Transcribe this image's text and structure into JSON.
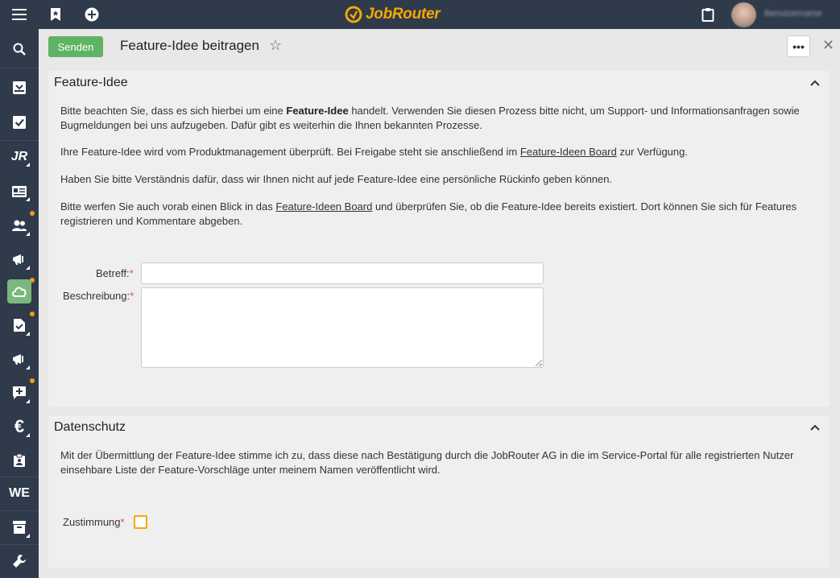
{
  "topbar": {
    "logo_text": "JobRouter",
    "icons": [
      "menu-icon",
      "bookmark-icon",
      "add-circle-icon",
      "clipboard-icon"
    ],
    "username": "Benutzername"
  },
  "sidebar": {
    "items": [
      {
        "name": "search-icon",
        "badge": false
      },
      {
        "name": "inbox-icon",
        "badge": false
      },
      {
        "name": "task-check-icon",
        "badge": false
      },
      {
        "name": "jr-icon",
        "text": "JR",
        "badge": false
      },
      {
        "name": "card-icon",
        "badge": false
      },
      {
        "name": "people-icon",
        "badge": true
      },
      {
        "name": "megaphone-icon",
        "badge": false
      },
      {
        "name": "cloud-icon",
        "badge": true,
        "active": true
      },
      {
        "name": "document-check-icon",
        "badge": true
      },
      {
        "name": "megaphone-2-icon",
        "badge": false
      },
      {
        "name": "feedback-icon",
        "badge": true
      },
      {
        "name": "euro-icon",
        "text": "€",
        "badge": false
      },
      {
        "name": "badge-icon",
        "badge": false
      },
      {
        "name": "we-icon",
        "text": "WE",
        "badge": false
      },
      {
        "name": "archive-icon",
        "badge": false
      },
      {
        "name": "wrench-icon",
        "badge": false
      }
    ]
  },
  "header": {
    "send_label": "Senden",
    "title": "Feature-Idee beitragen",
    "more_label": "•••"
  },
  "feature_panel": {
    "title": "Feature-Idee",
    "p1_a": "Bitte beachten Sie, dass es sich hierbei um eine ",
    "p1_b": "Feature-Idee",
    "p1_c": " handelt. Verwenden Sie diesen Prozess bitte nicht, um Support- und Informationsanfragen sowie Bugmeldungen bei uns aufzugeben. Dafür gibt es weiterhin die Ihnen bekannten Prozesse.",
    "p2_a": "Ihre Feature-Idee wird vom Produktmanagement überprüft. Bei Freigabe steht sie anschließend im ",
    "p2_link": "Feature-Ideen Board",
    "p2_c": " zur Verfügung.",
    "p3": "Haben Sie bitte Verständnis dafür, dass wir Ihnen nicht auf jede Feature-Idee eine persönliche Rückinfo geben können.",
    "p4_a": "Bitte werfen Sie auch vorab einen Blick in das ",
    "p4_link": "Feature-Ideen Board",
    "p4_c": " und überprüfen Sie, ob die Feature-Idee bereits existiert. Dort können Sie sich für Features registrieren und Kommentare abgeben.",
    "subject_label": "Betreff:",
    "subject_value": "",
    "description_label": "Beschreibung:",
    "description_value": "",
    "required_mark": "*"
  },
  "privacy_panel": {
    "title": "Datenschutz",
    "text": "Mit der Übermittlung der Feature-Idee stimme ich zu, dass diese nach Bestätigung durch die JobRouter AG in die im Service-Portal für alle registrierten Nutzer einsehbare Liste der Feature-Vorschläge unter meinem Namen veröffentlicht wird.",
    "consent_label": "Zustimmung",
    "consent_checked": false
  },
  "colors": {
    "topbar": "#2f3a4a",
    "send_button": "#5fb364",
    "logo": "#f5a800",
    "badge": "#f39c12",
    "required": "#e24c4c"
  }
}
